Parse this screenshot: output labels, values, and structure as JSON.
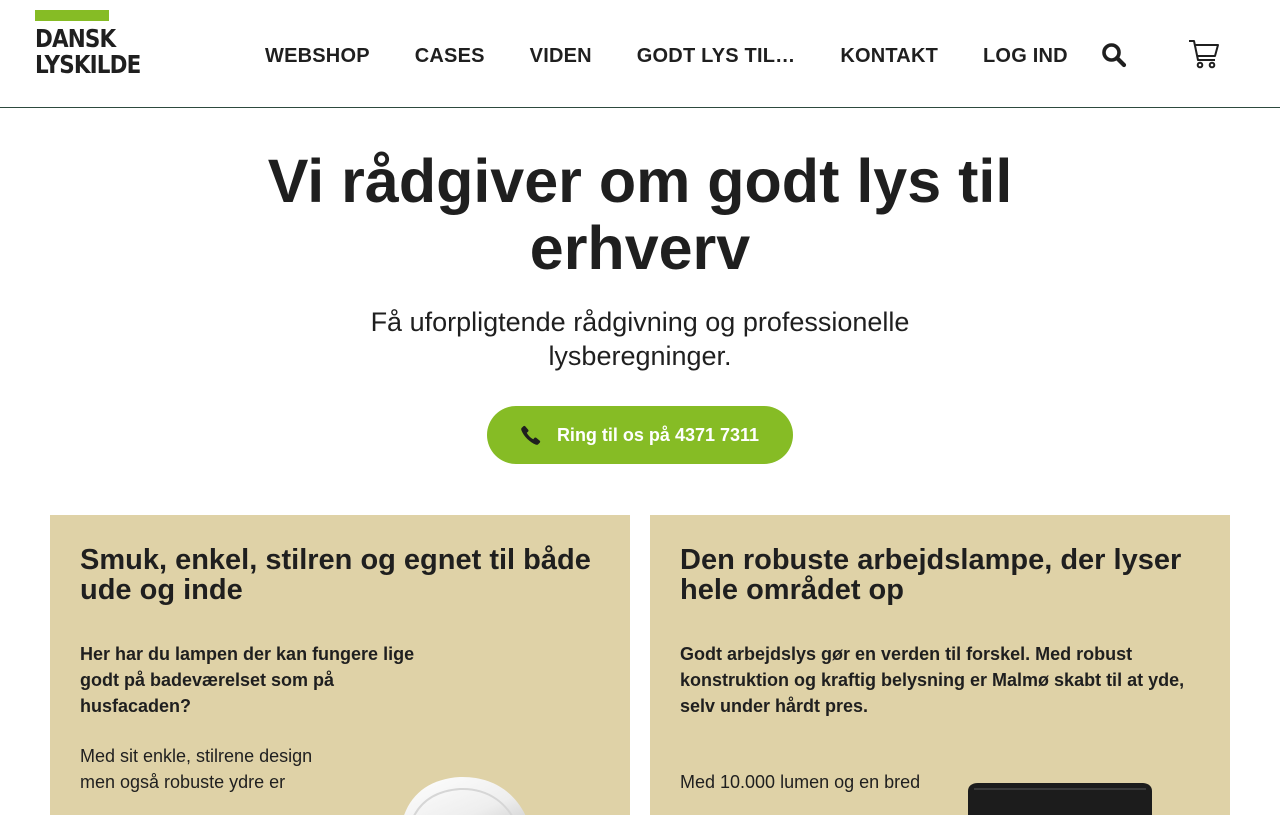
{
  "brand": {
    "line1": "DANSK",
    "line2": "LYSKILDE",
    "accent_color": "#86bc25"
  },
  "nav": {
    "items": [
      {
        "label": "WEBSHOP"
      },
      {
        "label": "CASES"
      },
      {
        "label": "VIDEN"
      },
      {
        "label": "GODT LYS TIL…"
      },
      {
        "label": "KONTAKT"
      },
      {
        "label": "LOG IND"
      }
    ],
    "search_icon": "search-icon",
    "cart_icon": "cart-icon"
  },
  "hero": {
    "title": "Vi rådgiver om godt lys til erhverv",
    "subtitle": "Få uforpligtende rådgivning og professionelle lysberegninger.",
    "cta_label": "Ring til os på 4371 7311",
    "cta_icon": "phone-icon",
    "cta_color": "#86bc25"
  },
  "cards": [
    {
      "title": "Smuk, enkel, stilren og egnet til både ude og inde",
      "lead": "Her har du lampen der kan fungere lige godt på badeværelset som på husfacaden?",
      "body": "Med sit enkle, stilrene design men også robuste ydre er"
    },
    {
      "title": "Den robuste arbejdslampe, der lyser hele området op",
      "lead": "Godt arbejdslys gør en verden til forskel. Med robust konstruktion og kraftig belysning er Malmø skabt til at yde, selv under hårdt pres.",
      "body": "Med 10.000 lumen og en bred"
    }
  ],
  "colors": {
    "card_background": "#dfd2a7",
    "header_border": "#2d4a3e",
    "text": "#1f1f1f"
  }
}
